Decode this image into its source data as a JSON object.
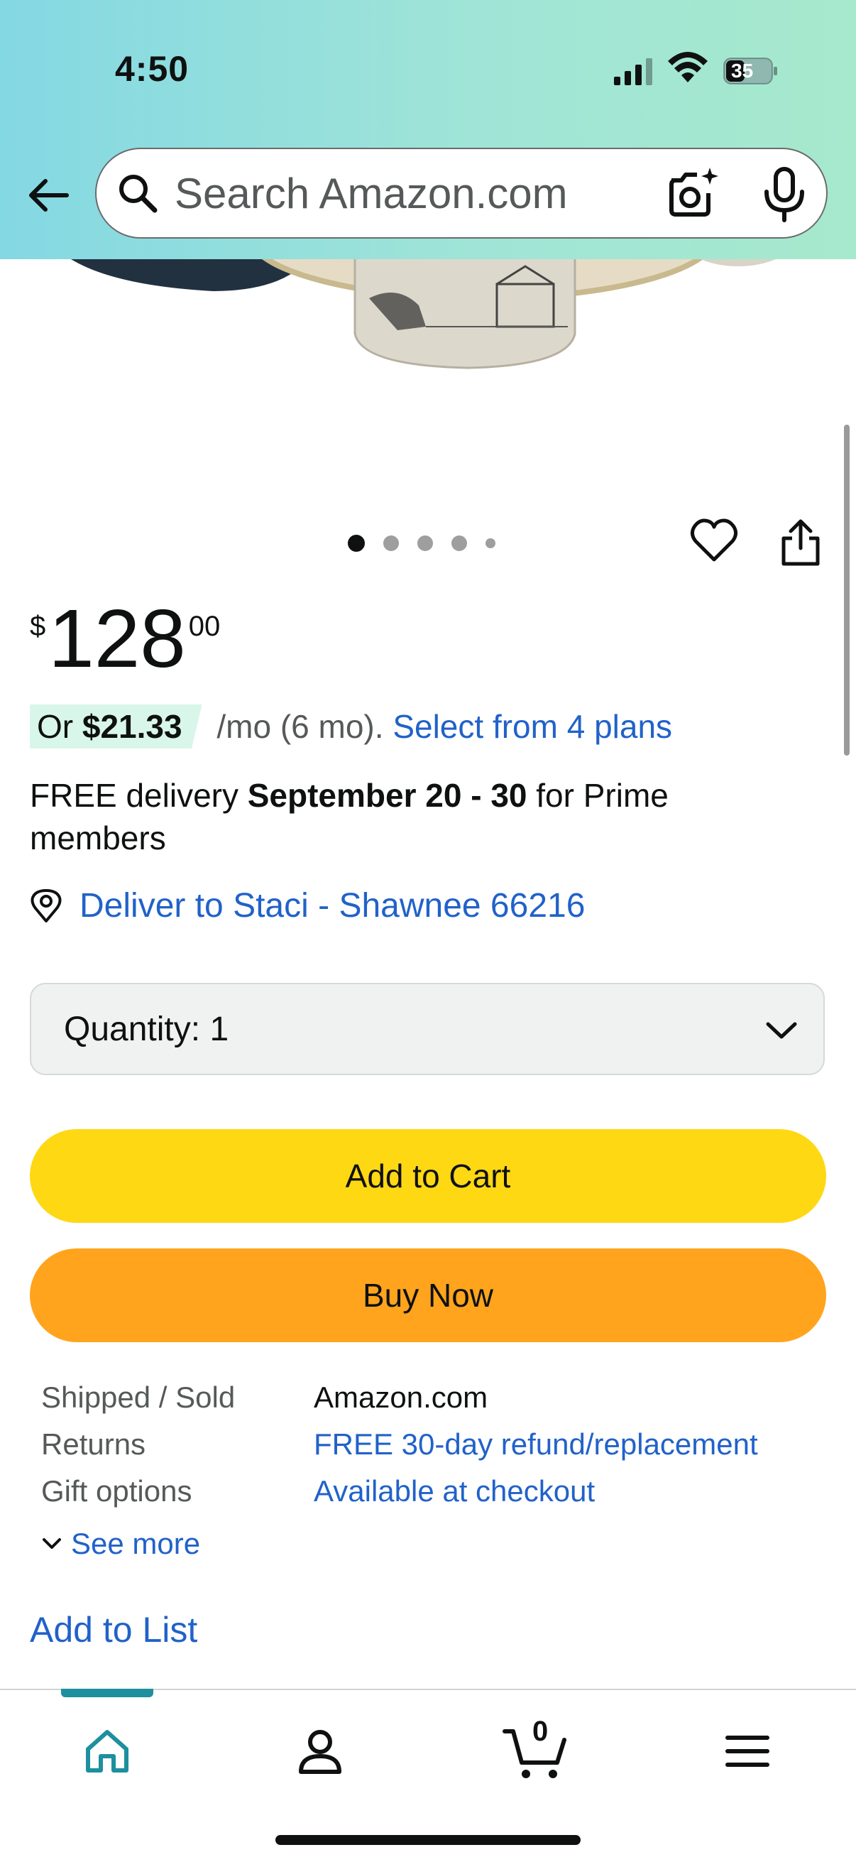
{
  "status_bar": {
    "time": "4:50",
    "battery": "35"
  },
  "search": {
    "placeholder": "Search Amazon.com"
  },
  "carousel": {
    "image_count": 5,
    "active_index": 0
  },
  "price": {
    "symbol": "$",
    "whole": "128",
    "fraction": "00"
  },
  "installment": {
    "prefix": "Or ",
    "amount": "$21.33",
    "terms": " /mo (6 mo). ",
    "link": "Select from 4 plans"
  },
  "delivery": {
    "prefix": "FREE delivery ",
    "dates": "September 20 - 30",
    "suffix": " for Prime members"
  },
  "deliver_to": "Deliver to Staci - Shawnee 66216",
  "quantity": {
    "label": "Quantity:",
    "value": "1"
  },
  "buttons": {
    "add_to_cart": "Add to Cart",
    "buy_now": "Buy Now"
  },
  "details": [
    {
      "key": "Shipped / Sold",
      "value": "Amazon.com",
      "link": false
    },
    {
      "key": "Returns",
      "value": "FREE 30-day refund/replacement",
      "link": true
    },
    {
      "key": "Gift options",
      "value": "Available at checkout",
      "link": true
    }
  ],
  "see_more": "See more",
  "add_to_list": "Add to List",
  "cart_count": "0",
  "colors": {
    "link": "#2162c9",
    "add_to_cart": "#ffd814",
    "buy_now": "#ffa41c",
    "accent_tab": "#1e8f9e",
    "installment_badge": "#d9f6ea"
  }
}
